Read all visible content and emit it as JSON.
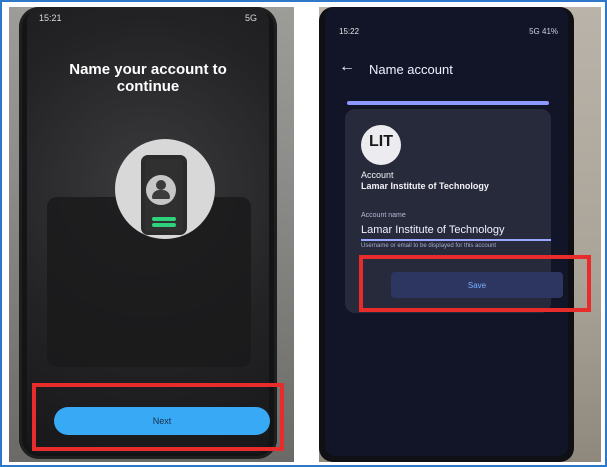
{
  "left_screen": {
    "status_time": "15:21",
    "status_right": "5G",
    "title": "Name your account to continue",
    "next_label": "Next"
  },
  "right_screen": {
    "status_time": "15:22",
    "status_right": "5G 41%",
    "header": {
      "back_icon": "arrow-left-icon",
      "title": "Name account"
    },
    "logo_text": "LIT",
    "account_label": "Account",
    "account_value": "Lamar Institute of Technology",
    "account_name_label": "Account name",
    "account_name_value": "Lamar Institute of Technology",
    "helper_text": "Username or email to be displayed for this account",
    "save_label": "Save"
  },
  "highlight_color": "#e82b2b",
  "frame_color": "#2f77c9",
  "accent_color": "#38a9f4"
}
